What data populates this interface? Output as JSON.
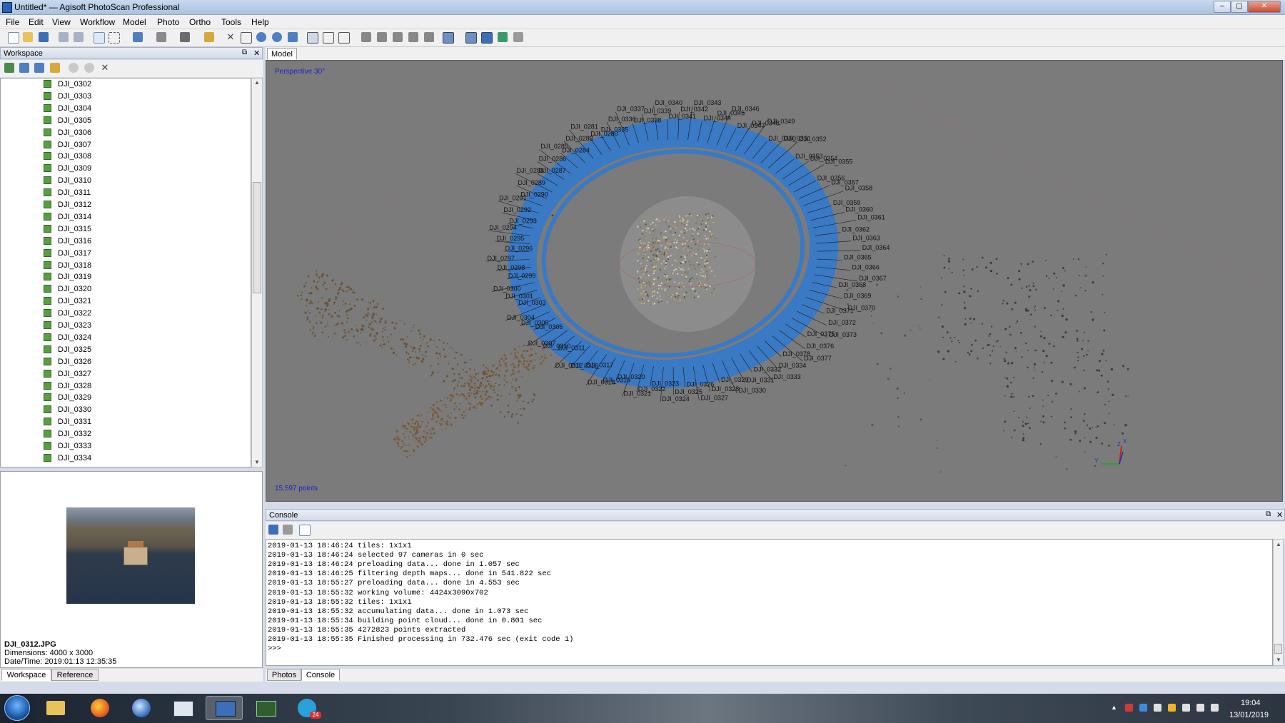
{
  "window": {
    "title": "Untitled* — Agisoft PhotoScan Professional",
    "controls": [
      "–",
      "▢",
      "✕"
    ]
  },
  "menu": [
    "File",
    "Edit",
    "View",
    "Workflow",
    "Model",
    "Photo",
    "Ortho",
    "Tools",
    "Help"
  ],
  "workspace": {
    "header": "Workspace",
    "items": [
      "DJI_0302",
      "DJI_0303",
      "DJI_0304",
      "DJI_0305",
      "DJI_0306",
      "DJI_0307",
      "DJI_0308",
      "DJI_0309",
      "DJI_0310",
      "DJI_0311",
      "DJI_0312",
      "DJI_0314",
      "DJI_0315",
      "DJI_0316",
      "DJI_0317",
      "DJI_0318",
      "DJI_0319",
      "DJI_0320",
      "DJI_0321",
      "DJI_0322",
      "DJI_0323",
      "DJI_0324",
      "DJI_0325",
      "DJI_0326",
      "DJI_0327",
      "DJI_0328",
      "DJI_0329",
      "DJI_0330",
      "DJI_0331",
      "DJI_0332",
      "DJI_0333",
      "DJI_0334"
    ]
  },
  "photo_info": {
    "filename": "DJI_0312.JPG",
    "dimensions": "Dimensions: 4000 x 3000",
    "datetime": "Date/Time: 2019:01:13 12:35:35"
  },
  "left_tabs": [
    "Workspace",
    "Reference"
  ],
  "model": {
    "tab": "Model",
    "view_mode": "Perspective 30°",
    "points": "15,597 points",
    "axis_labels": [
      "X",
      "Y",
      "Z"
    ],
    "cameras": [
      {
        "label": "DJI_0335"
      },
      {
        "label": "DJI_0336"
      },
      {
        "label": "DJI_0337"
      },
      {
        "label": "DJI_0338"
      },
      {
        "label": "DJI_0339"
      },
      {
        "label": "DJI_0340"
      },
      {
        "label": "DJI_0341"
      },
      {
        "label": "DJI_0342"
      },
      {
        "label": "DJI_0343"
      },
      {
        "label": "DJI_0344"
      },
      {
        "label": "DJI_0345"
      },
      {
        "label": "DJI_0346"
      },
      {
        "label": "DJI_0347"
      },
      {
        "label": "DJI_0348"
      },
      {
        "label": "DJI_0349"
      },
      {
        "label": "DJI_0350"
      },
      {
        "label": "DJI_0351"
      },
      {
        "label": "DJI_0352"
      },
      {
        "label": "DJI_0353"
      },
      {
        "label": "DJI_0354"
      },
      {
        "label": "DJI_0355"
      },
      {
        "label": "DJI_0356"
      },
      {
        "label": "DJI_0357"
      },
      {
        "label": "DJI_0358"
      },
      {
        "label": "DJI_0359"
      },
      {
        "label": "DJI_0360"
      },
      {
        "label": "DJI_0361"
      },
      {
        "label": "DJI_0362"
      },
      {
        "label": "DJI_0363"
      },
      {
        "label": "DJI_0364"
      },
      {
        "label": "DJI_0365"
      },
      {
        "label": "DJI_0366"
      },
      {
        "label": "DJI_0367"
      },
      {
        "label": "DJI_0368"
      },
      {
        "label": "DJI_0369"
      },
      {
        "label": "DJI_0370"
      },
      {
        "label": "DJI_0371"
      },
      {
        "label": "DJI_0372"
      },
      {
        "label": "DJI_0373"
      },
      {
        "label": "DJI_0375"
      },
      {
        "label": "DJI_0376"
      },
      {
        "label": "DJI_0377"
      },
      {
        "label": "DJI_0378"
      },
      {
        "label": "DJI_0334"
      },
      {
        "label": "DJI_0333"
      },
      {
        "label": "DJI_0332"
      },
      {
        "label": "DJI_0331"
      },
      {
        "label": "DJI_0330"
      },
      {
        "label": "DJI_0329"
      },
      {
        "label": "DJI_0328"
      },
      {
        "label": "DJI_0327"
      },
      {
        "label": "DJI_0326"
      },
      {
        "label": "DJI_0325"
      },
      {
        "label": "DJI_0324"
      },
      {
        "label": "DJI_0323"
      },
      {
        "label": "DJI_0322"
      },
      {
        "label": "DJI_0321"
      },
      {
        "label": "DJI_0320"
      },
      {
        "label": "DJI_0319"
      },
      {
        "label": "DJI_0318"
      },
      {
        "label": "DJI_0317"
      },
      {
        "label": "DJI_0316"
      },
      {
        "label": "DJI_0312"
      },
      {
        "label": "DJI_0311"
      },
      {
        "label": "DJI_0310"
      },
      {
        "label": "DJI_0307"
      },
      {
        "label": "DJI_0306"
      },
      {
        "label": "DJI_0305"
      },
      {
        "label": "DJI_0304"
      },
      {
        "label": "DJI_0303"
      },
      {
        "label": "DJI_0301"
      },
      {
        "label": "DJI_0300"
      },
      {
        "label": "DJI_0299"
      },
      {
        "label": "DJI_0298"
      },
      {
        "label": "DJI_0297"
      },
      {
        "label": "DJI_0296"
      },
      {
        "label": "DJI_0295"
      },
      {
        "label": "DJI_0294"
      },
      {
        "label": "DJI_0293"
      },
      {
        "label": "DJI_0292"
      },
      {
        "label": "DJI_0291"
      },
      {
        "label": "DJI_0290"
      },
      {
        "label": "DJI_0289"
      },
      {
        "label": "DJI_0288"
      },
      {
        "label": "DJI_0287"
      },
      {
        "label": "DJI_0286"
      },
      {
        "label": "DJI_0285"
      },
      {
        "label": "DJI_0284"
      },
      {
        "label": "DJI_0283"
      },
      {
        "label": "DJI_0281"
      },
      {
        "label": "DJI_0280"
      }
    ]
  },
  "console": {
    "header": "Console",
    "lines": [
      "2019-01-13 18:46:24 tiles: 1x1x1",
      "2019-01-13 18:46:24 selected 97 cameras in 0 sec",
      "2019-01-13 18:46:24 preloading data... done in 1.057 sec",
      "2019-01-13 18:46:25 filtering depth maps... done in 541.822 sec",
      "2019-01-13 18:55:27 preloading data... done in 4.553 sec",
      "2019-01-13 18:55:32 working volume: 4424x3090x702",
      "2019-01-13 18:55:32 tiles: 1x1x1",
      "2019-01-13 18:55:32 accumulating data... done in 1.073 sec",
      "2019-01-13 18:55:34 building point cloud... done in 0.801 sec",
      "2019-01-13 18:55:35 4272823 points extracted",
      "2019-01-13 18:55:35 Finished processing in 732.476 sec (exit code 1)",
      ">>>"
    ]
  },
  "right_tabs": [
    "Photos",
    "Console"
  ],
  "taskbar": {
    "time": "19:04",
    "date": "13/01/2019",
    "badge": "24"
  },
  "colors": {
    "viewport": "#7b7b7b",
    "camera_blue": "#3a79c4",
    "title_gradient": "#a9c1e0"
  }
}
